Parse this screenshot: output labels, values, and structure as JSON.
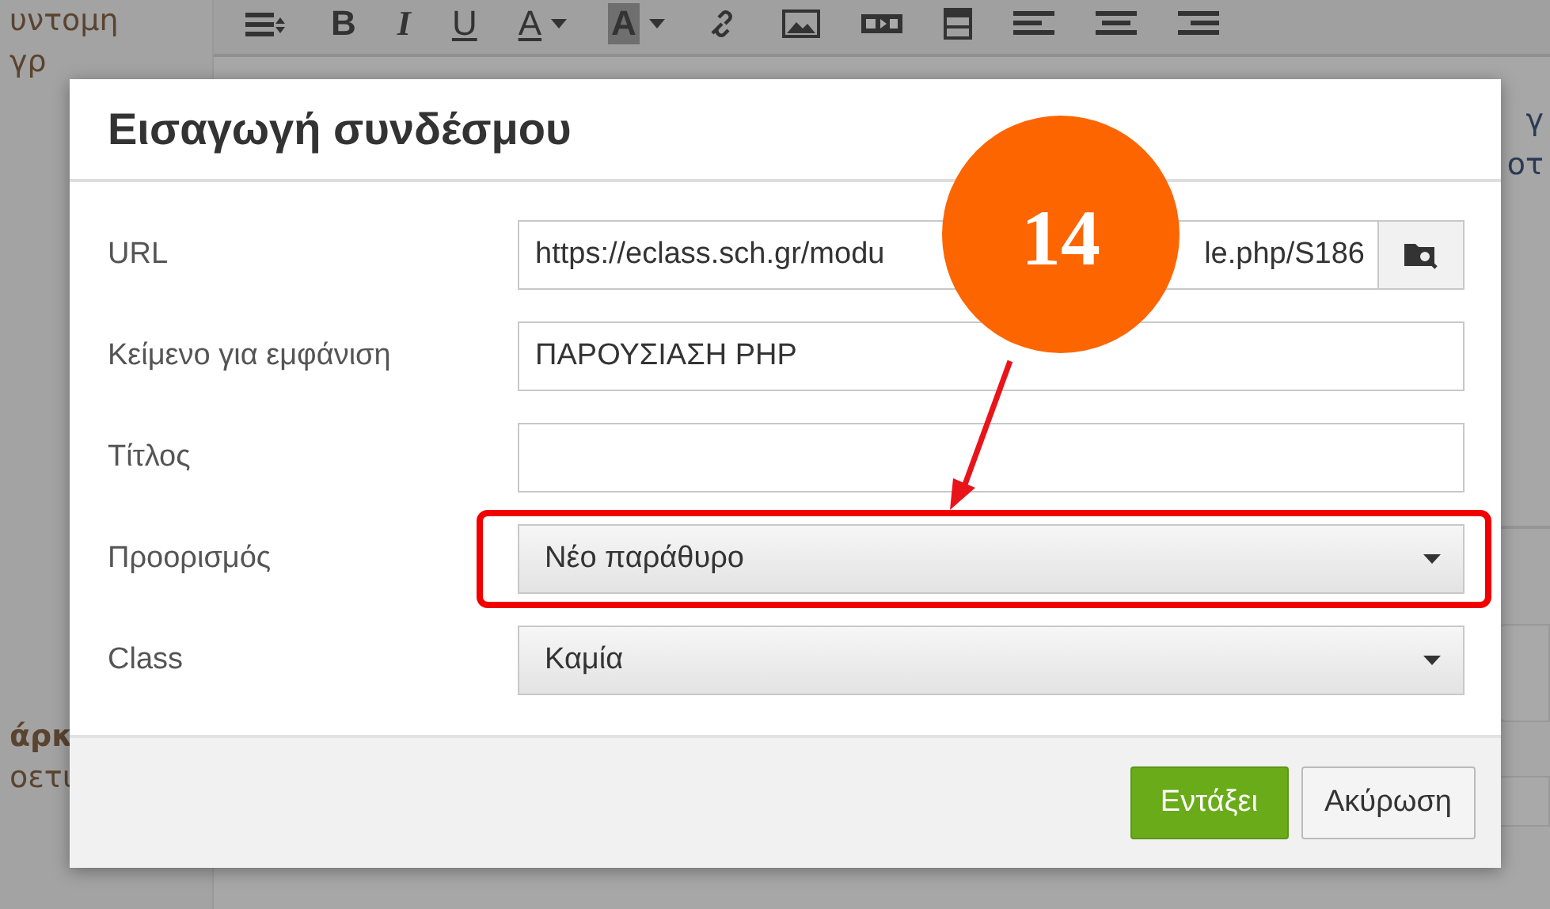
{
  "background": {
    "sidebar_top": [
      "υντομη",
      "γρ"
    ],
    "sidebar_bottom": [
      "άρκ",
      "οετι"
    ],
    "right_text": [
      "γ",
      "οτ"
    ],
    "toolbar": [
      {
        "kind": "format"
      },
      {
        "kind": "bold",
        "text": "B"
      },
      {
        "kind": "italic",
        "text": "I"
      },
      {
        "kind": "underline",
        "text": "U"
      },
      {
        "kind": "text-color",
        "text": "A"
      },
      {
        "kind": "bg-color",
        "text": "A"
      },
      {
        "kind": "link"
      },
      {
        "kind": "image"
      },
      {
        "kind": "media"
      },
      {
        "kind": "table"
      },
      {
        "kind": "align-left"
      },
      {
        "kind": "align-center"
      },
      {
        "kind": "align-right"
      }
    ]
  },
  "dialog": {
    "title": "Εισαγωγή συνδέσμου",
    "fields": [
      {
        "kind": "url",
        "label": "URL",
        "value_start": "https://eclass.sch.gr/modu",
        "value_end": "le.php/S186"
      },
      {
        "kind": "text",
        "label": "Κείμενο για εμφάνιση",
        "value": "ΠΑΡΟΥΣΙΑΣΗ PHP"
      },
      {
        "kind": "text",
        "label": "Τίτλος"
      },
      {
        "kind": "select",
        "label": "Προορισμός",
        "value": "Νέο παράθυρο",
        "highlighted": true
      },
      {
        "kind": "select",
        "label": "Class",
        "value": "Καμία",
        "highlighted": false
      }
    ],
    "buttons": [
      {
        "label": "Εντάξει",
        "primary": true
      },
      {
        "label": "Ακύρωση",
        "primary": false
      }
    ]
  },
  "annotation": {
    "label": "14"
  }
}
